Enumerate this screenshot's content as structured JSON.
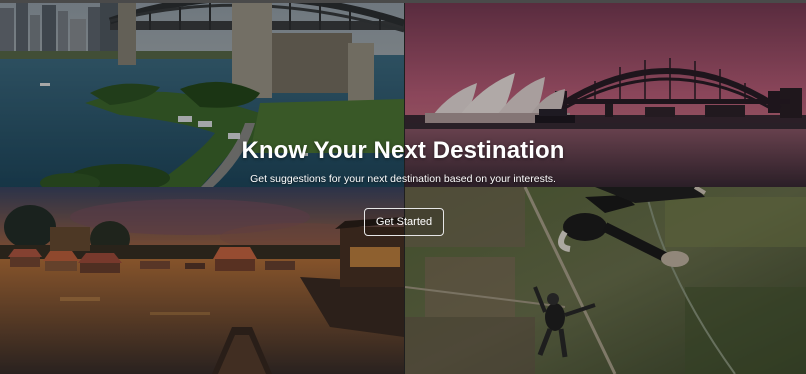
{
  "hero": {
    "title": "Know Your Next Destination",
    "subtitle": "Get suggestions for your next destination based on your interests.",
    "cta_label": "Get Started"
  },
  "images": [
    {
      "subject": "Sydney Harbour Bridge from the shoreline"
    },
    {
      "subject": "Sydney Opera House and Harbour Bridge at dusk"
    },
    {
      "subject": "Wooden boats on a lake at sunset"
    },
    {
      "subject": "Skydivers in free fall above farmland"
    }
  ],
  "colors": {
    "overlay": "rgba(0,0,0,0.28)",
    "text": "#ffffff",
    "button_border": "#e6e6e6"
  }
}
